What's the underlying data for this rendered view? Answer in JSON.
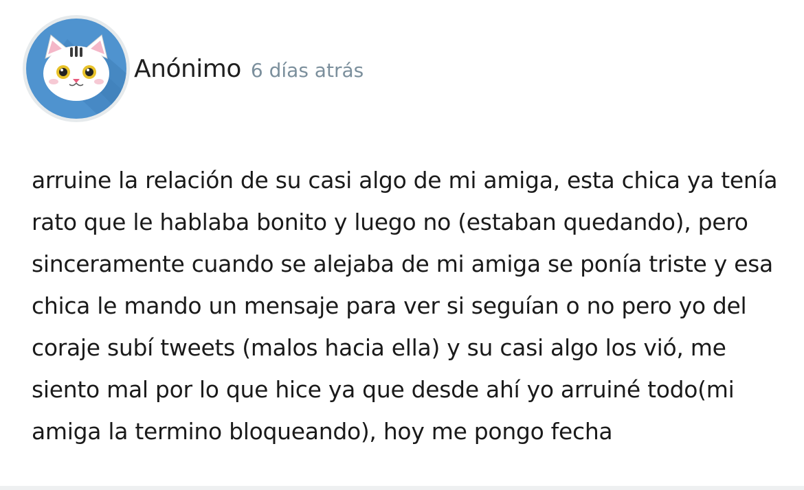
{
  "post": {
    "author": "Anónimo",
    "time_ago": "6 días atrás",
    "avatar_icon": "cat-avatar-icon",
    "avatar_color": "#4f93cf",
    "body_lines": [
      "arruine la relación de su casi algo de mi amiga, esta chica ya tenía",
      "rato que le hablaba bonito y luego no (estaban quedando), pero",
      "sinceramente cuando se alejaba de mi amiga se ponía triste y esa",
      "chica le mando un mensaje para ver si seguían o no pero yo del",
      "coraje subí tweets (malos hacia ella) y su casi algo los vió, me",
      "siento mal por lo que hice ya que desde ahí yo arruiné todo(mi",
      "amiga la termino bloqueando), hoy me pongo fecha"
    ]
  }
}
